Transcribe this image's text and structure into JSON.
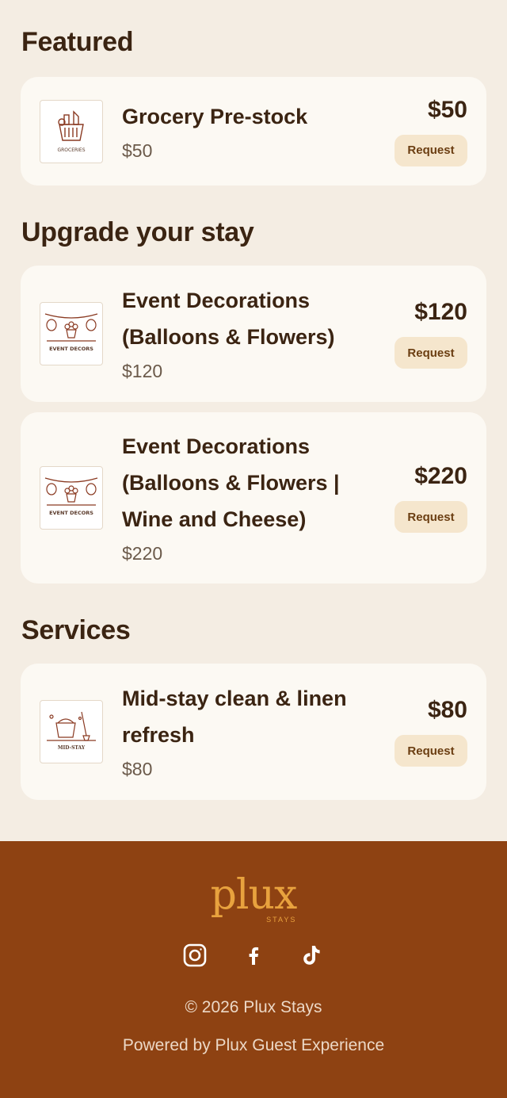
{
  "sections": {
    "featured": {
      "title": "Featured",
      "items": [
        {
          "title": "Grocery Pre-stock",
          "price_sub": "$50",
          "price": "$50",
          "button": "Request",
          "thumb_label": "GROCERIES",
          "thumb_icon": "grocery-basket-icon"
        }
      ]
    },
    "upgrade": {
      "title": "Upgrade your stay",
      "items": [
        {
          "title_line1": "Event Decorations",
          "title_line2": "(Balloons & Flowers)",
          "price_sub": "$120",
          "price": "$120",
          "button": "Request",
          "thumb_label": "EVENT DECORS",
          "thumb_icon": "balloons-flowers-icon"
        },
        {
          "title_line1": "Event Decorations",
          "title_line2": "(Balloons & Flowers |",
          "title_line3": "Wine and Cheese)",
          "price_sub": "$220",
          "price": "$220",
          "button": "Request",
          "thumb_label": "EVENT DECORS",
          "thumb_icon": "balloons-flowers-icon"
        }
      ]
    },
    "services": {
      "title": "Services",
      "items": [
        {
          "title_line1": "Mid-stay clean & linen",
          "title_line2": "refresh",
          "price_sub": "$80",
          "price": "$80",
          "button": "Request",
          "thumb_label": "MID-STAY",
          "thumb_icon": "cleaning-bucket-icon"
        }
      ]
    }
  },
  "footer": {
    "logo_word": "plux",
    "logo_sub": "STAYS",
    "socials": [
      "instagram-icon",
      "facebook-icon",
      "tiktok-icon"
    ],
    "copyright": "© 2026 Plux Stays",
    "powered": "Powered by Plux Guest Experience"
  },
  "colors": {
    "background": "#f4ede3",
    "card": "#fcf9f3",
    "text": "#3b2412",
    "button_bg": "#f5e6cd",
    "footer_bg": "#8e4212",
    "logo": "#e8a23e"
  }
}
